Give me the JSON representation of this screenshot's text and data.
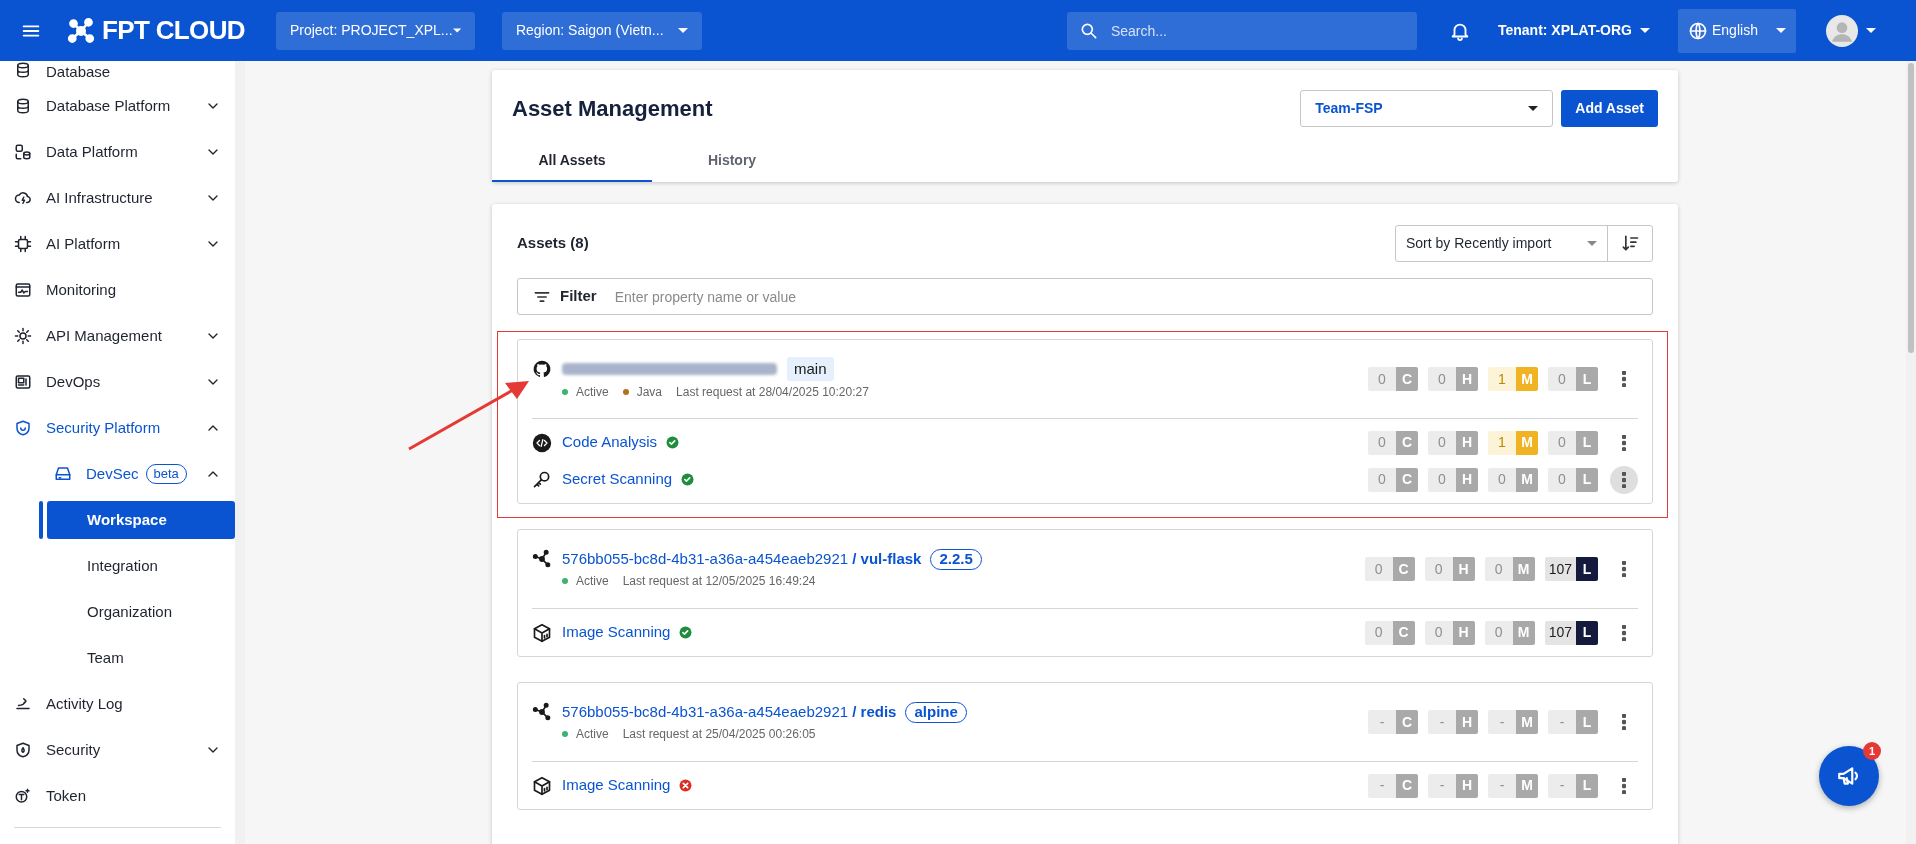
{
  "topbar": {
    "logo": "FPT CLOUD",
    "project": "Project: PROJECT_XPL...",
    "region": "Region: Saigon (Vietn...",
    "search": {
      "placeholder": "Search..."
    },
    "tenant": "Tenant: XPLAT-ORG",
    "language": "English"
  },
  "sidebar": {
    "items": [
      {
        "label": "Database",
        "active": false
      },
      {
        "label": "Database Platform",
        "active": false,
        "expanded": false
      },
      {
        "label": "Data Platform",
        "active": false,
        "expanded": false
      },
      {
        "label": "AI Infrastructure",
        "active": false,
        "expanded": false
      },
      {
        "label": "AI Platform",
        "active": false,
        "expanded": false
      },
      {
        "label": "Monitoring",
        "active": false
      },
      {
        "label": "API Management",
        "active": false,
        "expanded": false
      },
      {
        "label": "DevOps",
        "active": false,
        "expanded": false
      },
      {
        "label": "Security Platform",
        "active": true,
        "expanded": true,
        "children": [
          {
            "label": "DevSec",
            "badge": "beta",
            "active": true,
            "expanded": true,
            "children": [
              {
                "label": "Workspace",
                "selected": true
              },
              {
                "label": "Integration",
                "selected": false
              },
              {
                "label": "Organization",
                "selected": false
              },
              {
                "label": "Team",
                "selected": false
              }
            ]
          }
        ]
      },
      {
        "label": "Activity Log",
        "active": false
      },
      {
        "label": "Security",
        "active": false,
        "expanded": false
      },
      {
        "label": "Token",
        "active": false
      }
    ]
  },
  "header": {
    "title": "Asset Management",
    "team": "Team-FSP",
    "add_button": "Add Asset",
    "tabs": [
      {
        "label": "All Assets",
        "selected": true
      },
      {
        "label": "History",
        "selected": false
      }
    ]
  },
  "assets_panel": {
    "title": "Assets (8)",
    "sort": "Sort by Recently import",
    "filter": {
      "label": "Filter",
      "placeholder": "Enter property name or value"
    },
    "assets": [
      {
        "kind": "repository",
        "name_blurred": true,
        "highlighted": true,
        "tag": {
          "kind": "branch",
          "text": "main"
        },
        "meta": [
          {
            "text": "Active",
            "color": "#3cb371"
          },
          {
            "text": "Java",
            "color": "#b07219"
          }
        ],
        "last_request": "Last request at 28/04/2025 10:20:27",
        "menu_highlighted": false,
        "severity": [
          {
            "count": "0",
            "letter": "C",
            "active": false
          },
          {
            "count": "0",
            "letter": "H",
            "active": false
          },
          {
            "count": "1",
            "letter": "M",
            "active": true
          },
          {
            "count": "0",
            "letter": "L",
            "active": false
          }
        ],
        "scans": [
          {
            "kind": "code",
            "name": "Code Analysis",
            "passed": true,
            "menu_highlighted": false,
            "severity": [
              {
                "count": "0",
                "letter": "C",
                "active": false
              },
              {
                "count": "0",
                "letter": "H",
                "active": false
              },
              {
                "count": "1",
                "letter": "M",
                "active": true
              },
              {
                "count": "0",
                "letter": "L",
                "active": false
              }
            ]
          },
          {
            "kind": "secret",
            "name": "Secret Scanning",
            "passed": true,
            "menu_highlighted": true,
            "severity": [
              {
                "count": "0",
                "letter": "C",
                "active": false
              },
              {
                "count": "0",
                "letter": "H",
                "active": false
              },
              {
                "count": "0",
                "letter": "M",
                "active": false
              },
              {
                "count": "0",
                "letter": "L",
                "active": false
              }
            ]
          }
        ]
      },
      {
        "kind": "image",
        "name_blurred": false,
        "owner": "576bb055-bc8d-4b31-a36a-a454eaeb2921",
        "name": "/ vul-flask",
        "highlighted": false,
        "tag": {
          "kind": "version",
          "text": "2.2.5"
        },
        "meta": [
          {
            "text": "Active",
            "color": "#3cb371"
          }
        ],
        "last_request": "Last request at 12/05/2025 16:49:24",
        "menu_highlighted": false,
        "severity": [
          {
            "count": "0",
            "letter": "C",
            "active": false
          },
          {
            "count": "0",
            "letter": "H",
            "active": false
          },
          {
            "count": "0",
            "letter": "M",
            "active": false
          },
          {
            "count": "107",
            "letter": "L",
            "active": true
          }
        ],
        "scans": [
          {
            "kind": "image",
            "name": "Image Scanning",
            "passed": true,
            "menu_highlighted": false,
            "severity": [
              {
                "count": "0",
                "letter": "C",
                "active": false
              },
              {
                "count": "0",
                "letter": "H",
                "active": false
              },
              {
                "count": "0",
                "letter": "M",
                "active": false
              },
              {
                "count": "107",
                "letter": "L",
                "active": true
              }
            ]
          }
        ]
      },
      {
        "kind": "image",
        "name_blurred": false,
        "owner": "576bb055-bc8d-4b31-a36a-a454eaeb2921",
        "name": "/ redis",
        "highlighted": false,
        "tag": {
          "kind": "version",
          "text": "alpine"
        },
        "meta": [
          {
            "text": "Active",
            "color": "#3cb371"
          }
        ],
        "last_request": "Last request at 25/04/2025 00:26:05",
        "menu_highlighted": false,
        "severity": [
          {
            "count": "-",
            "letter": "C",
            "active": false
          },
          {
            "count": "-",
            "letter": "H",
            "active": false
          },
          {
            "count": "-",
            "letter": "M",
            "active": false
          },
          {
            "count": "-",
            "letter": "L",
            "active": false
          }
        ],
        "scans": [
          {
            "kind": "image",
            "name": "Image Scanning",
            "passed": false,
            "menu_highlighted": false,
            "severity": [
              {
                "count": "-",
                "letter": "C",
                "active": false
              },
              {
                "count": "-",
                "letter": "H",
                "active": false
              },
              {
                "count": "-",
                "letter": "M",
                "active": false
              },
              {
                "count": "-",
                "letter": "L",
                "active": false
              }
            ]
          }
        ]
      }
    ]
  },
  "notification_button": {
    "badge": "1"
  }
}
